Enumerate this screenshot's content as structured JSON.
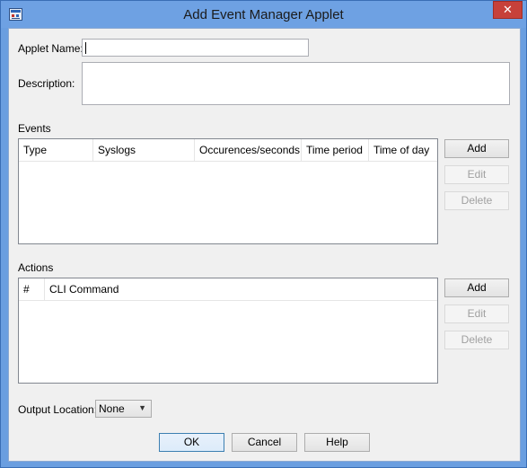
{
  "window": {
    "title": "Add Event Manager Applet",
    "close_glyph": "✕"
  },
  "form": {
    "applet_name_label": "Applet Name:",
    "applet_name_value": "",
    "description_label": "Description:",
    "description_value": ""
  },
  "events": {
    "section_label": "Events",
    "columns": [
      "Type",
      "Syslogs",
      "Occurences/seconds",
      "Time period",
      "Time of day"
    ],
    "rows": [],
    "add_label": "Add",
    "edit_label": "Edit",
    "delete_label": "Delete"
  },
  "actions": {
    "section_label": "Actions",
    "columns": [
      "#",
      "CLI Command"
    ],
    "rows": [],
    "add_label": "Add",
    "edit_label": "Edit",
    "delete_label": "Delete"
  },
  "output": {
    "label": "Output Location:",
    "selected": "None"
  },
  "footer": {
    "ok_label": "OK",
    "cancel_label": "Cancel",
    "help_label": "Help"
  }
}
